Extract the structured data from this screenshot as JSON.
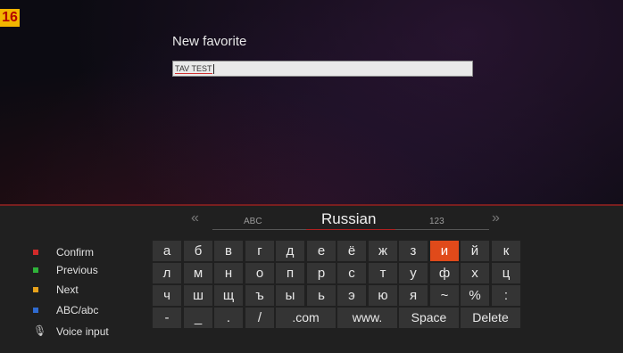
{
  "badge": "16",
  "dialog": {
    "title": "New favorite",
    "input_value": "TAV TEST"
  },
  "keyboard_tabs": {
    "left_arrow": "«",
    "right_arrow": "»",
    "abc": "ABC",
    "active": "Russian",
    "num": "123"
  },
  "legend": [
    {
      "label": "Confirm",
      "color": "#d12a2a"
    },
    {
      "label": "Previous",
      "color": "#2fb33a"
    },
    {
      "label": "Next",
      "color": "#e8a21b"
    },
    {
      "label": "ABC/abc",
      "color": "#2f6bd1"
    },
    {
      "label": "Voice input",
      "icon": "microphone-icon"
    }
  ],
  "keys": {
    "row1": [
      "а",
      "б",
      "в",
      "г",
      "д",
      "е",
      "ё",
      "ж",
      "з",
      "и",
      "й",
      "к"
    ],
    "row2": [
      "л",
      "м",
      "н",
      "о",
      "п",
      "р",
      "с",
      "т",
      "у",
      "ф",
      "х",
      "ц"
    ],
    "row3": [
      "ч",
      "ш",
      "щ",
      "ъ",
      "ы",
      "ь",
      "э",
      "ю",
      "я",
      "~",
      "%",
      ":"
    ],
    "row4": [
      "-",
      "_",
      ".",
      "/",
      ".com",
      "www.",
      "Space",
      "Delete"
    ],
    "selected": "и"
  }
}
